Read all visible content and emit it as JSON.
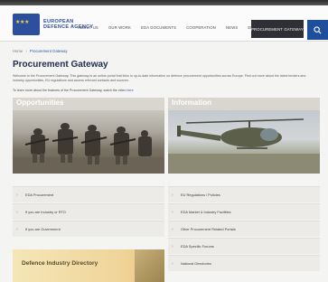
{
  "header": {
    "logo_text": "EUROPEAN DEFENCE AGENCY",
    "nav": [
      "ABOUT US",
      "OUR WORK",
      "EDA DOCUMENTS",
      "COOPERATION",
      "NEWS",
      "ENG"
    ],
    "cta_label": "PROCUREMENT GATEWAY"
  },
  "breadcrumb": [
    "Home",
    "Procurement Gateway"
  ],
  "page_title": "Procurement Gateway",
  "intro_text": "Welcome to the Procurement Gateway. This gateway is an online portal that links to up-to-date information on defence procurement opportunities across Europe. Find out more about the latest tenders and industry opportunities, EU regulations and access relevant contacts and sources.",
  "intro_link_line": {
    "prefix": "To learn more about the features of the Procurement Gateway, watch the video ",
    "link": "here",
    "suffix": ""
  },
  "columns": {
    "left": {
      "heading": "Opportunities",
      "items": [
        "EDA Procurement",
        "If you are Industry or RTO",
        "If you are Government"
      ]
    },
    "right": {
      "heading": "Information",
      "items": [
        "EU Regulations / Policies",
        "EDA Market & Industry Facilities",
        "Other Procurement Related Portals",
        "EDA Specific Forums",
        "National Directories"
      ]
    }
  },
  "banner_text": "Defence Industry Directory",
  "colors": {
    "brand_blue": "#1d4f9c",
    "title": "#1f2d4d"
  }
}
